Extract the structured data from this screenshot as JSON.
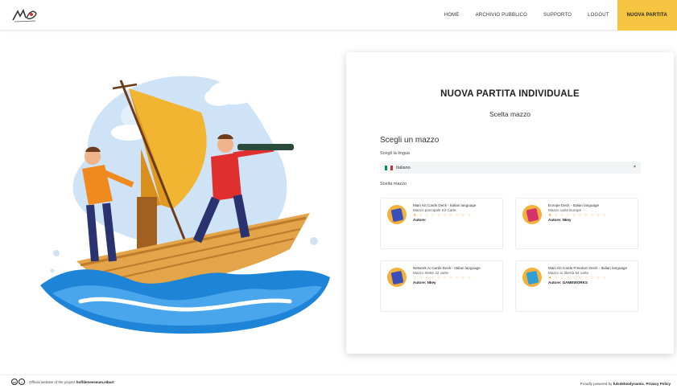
{
  "header": {
    "logo_icon": "handwritten-logo",
    "nav": [
      {
        "label": "HOME"
      },
      {
        "label": "ARCHIVIO PUBBLICO"
      },
      {
        "label": "SUPPORTO"
      },
      {
        "label": "LOGOUT"
      },
      {
        "label": "NUOVA PARTITA",
        "active": true
      }
    ]
  },
  "illustration": {
    "icon": "sailboat-explorers-illustration"
  },
  "card": {
    "title": "NUOVA PARTITA INDIVIDUALE",
    "subtitle": "Scelta mazzo",
    "section_title": "Scegli un mazzo",
    "language_label": "Scegli la lingua",
    "language_value": "Italiano",
    "language_flag_colors": [
      "#009246",
      "#ffffff",
      "#ce2b37"
    ],
    "decks_label": "Scelta mazzo",
    "decks": [
      {
        "name": "Main Kit Cards Deck - Italian language",
        "meta": "Mazzo principale Kit Carte",
        "stars": "★ ☆ ☆ ☆ ☆ ☆ ☆ ☆ ☆ ☆",
        "author": "Autore:",
        "color": "#3b4fb8"
      },
      {
        "name": "Europe Deck - Italian language",
        "meta": "Mazzo carte Europe",
        "stars": "★ ☆ ☆ ☆ ☆ ☆ ☆ ☆ ☆ ☆",
        "author": "Autore: Nkey",
        "color": "#d6336c"
      },
      {
        "name": "Network Ai Cards Deck - Italian language",
        "meta": "Mazzo rilette 22 carte",
        "stars": "☆ ☆ ☆ ☆ ☆ ☆ ☆ ☆ ☆ ☆",
        "author": "Autore: Nkey",
        "color": "#3b4fb8"
      },
      {
        "name": "Main Kit Cards Freedom Deck - Italian language",
        "meta": "Mazzo in libertà 64 carte",
        "stars": "★ ☆ ☆ ☆ ☆ ☆ ☆ ☆ ☆ ☆",
        "author": "Autore: GAMEWORKS",
        "color": "#2f9fd8"
      }
    ]
  },
  "footer": {
    "license_icon": "creative-commons-icon",
    "left_prefix": "Official website of the project",
    "left_link": "hoffdeneeseum.eiburt",
    "right_prefix": "Proudly powered by",
    "right_link": "fulsdebiodynamic",
    "right_suffix": "Privacy Policy"
  }
}
